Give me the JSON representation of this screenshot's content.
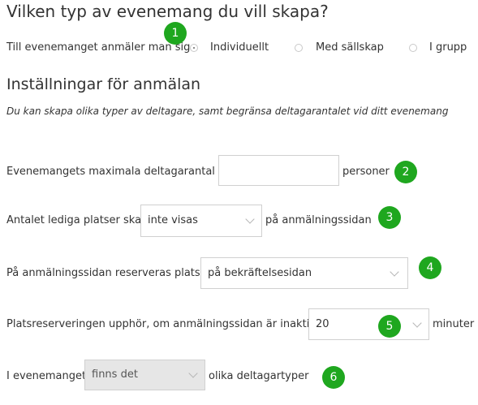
{
  "event_type": {
    "title": "Vilken typ av evenemang du vill skapa?",
    "prompt": "Till evenemanget anmäler man sig",
    "options": [
      "Individuellt",
      "Med sällskap",
      "I grupp"
    ],
    "selected": "Individuellt"
  },
  "settings": {
    "title": "Inställningar för anmälan",
    "subtitle": "Du kan skapa olika typer av deltagare, samt begränsa deltagarantalet vid ditt evenemang",
    "max_participants": {
      "label_before": "Evenemangets maximala deltagarantal är",
      "value": "",
      "label_after": "personer"
    },
    "free_spots": {
      "label_before": "Antalet lediga platser skall",
      "value": "inte visas",
      "label_after": "på anmälningssidan"
    },
    "reserve": {
      "label_before": "På anmälningssidan reserveras platser",
      "value": "på bekräftelsesidan"
    },
    "expiry": {
      "label_before": "Platsreserveringen upphör, om anmälningssidan är inaktiv i",
      "value": "20",
      "label_after": "minuter"
    },
    "types": {
      "label_before": "I evenemanget",
      "value": "finns det",
      "label_after": "olika deltagartyper"
    }
  },
  "badges": [
    "1",
    "2",
    "3",
    "4",
    "5",
    "6"
  ],
  "colors": {
    "badge": "#1fa71f",
    "text": "#333333",
    "border": "#d0d0d0",
    "disabled": "#e6e6e6"
  }
}
